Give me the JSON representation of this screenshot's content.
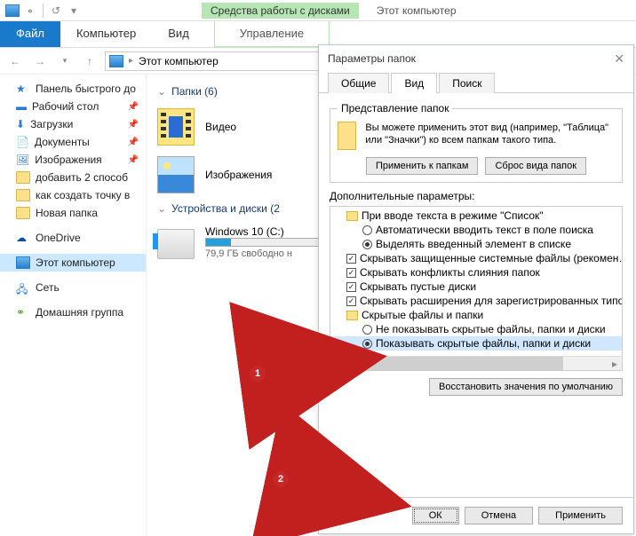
{
  "titlebar": {
    "context_tab": "Средства работы с дисками",
    "window_title": "Этот компьютер"
  },
  "ribbon": {
    "file": "Файл",
    "computer": "Компьютер",
    "view": "Вид",
    "manage": "Управление"
  },
  "address": {
    "location": "Этот компьютер"
  },
  "nav": {
    "quick": "Панель быстрого до",
    "desktop": "Рабочий стол",
    "downloads": "Загрузки",
    "documents": "Документы",
    "pictures": "Изображения",
    "add2": "добавить 2 способ",
    "howto": "как создать точку в",
    "newfolder": "Новая папка",
    "onedrive": "OneDrive",
    "thispc": "Этот компьютер",
    "network": "Сеть",
    "homegroup": "Домашняя группа"
  },
  "content": {
    "folders_header": "Папки (6)",
    "videos": "Видео",
    "pictures": "Изображения",
    "drives_header": "Устройства и диски (2",
    "drive_name": "Windows 10 (C:)",
    "drive_free": "79,9 ГБ свободно н"
  },
  "dialog": {
    "title": "Параметры папок",
    "tab_general": "Общие",
    "tab_view": "Вид",
    "tab_search": "Поиск",
    "fieldset_title": "Представление папок",
    "rep_text": "Вы можете применить этот вид (например, \"Таблица\" или \"Значки\") ко всем папкам такого типа.",
    "apply_folders": "Применить к папкам",
    "reset_folders": "Сброс вида папок",
    "adv_label": "Дополнительные параметры:",
    "tree": {
      "g1": "При вводе текста в режиме \"Список\"",
      "g1a": "Автоматически вводить текст в поле поиска",
      "g1b": "Выделять введенный элемент в списке",
      "c1": "Скрывать защищенные системные файлы (рекомен…",
      "c2": "Скрывать конфликты слияния папок",
      "c3": "Скрывать пустые диски",
      "c4": "Скрывать расширения для зарегистрированных типо",
      "g2": "Скрытые файлы и папки",
      "g2a": "Не показывать скрытые файлы, папки и диски",
      "g2b": "Показывать скрытые файлы, папки и диски"
    },
    "restore": "Восстановить значения по умолчанию",
    "ok": "ОК",
    "cancel": "Отмена",
    "apply": "Применить"
  }
}
